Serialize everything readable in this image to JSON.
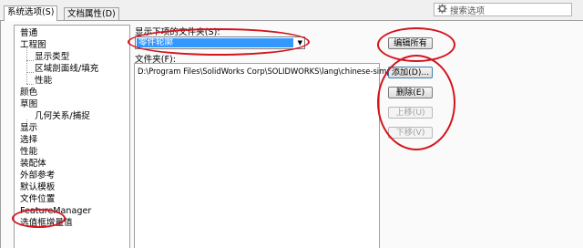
{
  "tabs": [
    {
      "label": "系统选项(S)",
      "active": true
    },
    {
      "label": "文档属性(D)",
      "active": false
    }
  ],
  "search": {
    "placeholder": "搜索选项",
    "icon": "gear-icon"
  },
  "tree": {
    "items": [
      {
        "label": "普通",
        "level": 1
      },
      {
        "label": "工程图",
        "level": 1
      },
      {
        "label": "显示类型",
        "level": 2
      },
      {
        "label": "区域剖面线/填充",
        "level": 2
      },
      {
        "label": "性能",
        "level": 2
      },
      {
        "label": "颜色",
        "level": 1
      },
      {
        "label": "草图",
        "level": 1
      },
      {
        "label": "几何关系/捕捉",
        "level": 2
      },
      {
        "label": "显示",
        "level": 1
      },
      {
        "label": "选择",
        "level": 1
      },
      {
        "label": "性能",
        "level": 1
      },
      {
        "label": "装配体",
        "level": 1
      },
      {
        "label": "外部参考",
        "level": 1
      },
      {
        "label": "默认模板",
        "level": 1
      },
      {
        "label": "文件位置",
        "level": 1,
        "selected": true
      },
      {
        "label": "FeatureManager",
        "level": 1
      },
      {
        "label": "选值框增量值",
        "level": 1
      }
    ]
  },
  "folder_type": {
    "label": "显示下项的文件夹(S):",
    "value": "零件轮廓"
  },
  "folders": {
    "label": "文件夹(F):",
    "items": [
      "D:\\Program Files\\SolidWorks Corp\\SOLIDWORKS\\lang\\chinese-simplified"
    ]
  },
  "buttons": {
    "edit_all": "编辑所有",
    "add": "添加(D)...",
    "delete": "删除(E)",
    "move_up": "上移(U)",
    "move_down": "下移(V)"
  },
  "colors": {
    "annotation": "#d4141e",
    "selection": "#3399ff"
  }
}
